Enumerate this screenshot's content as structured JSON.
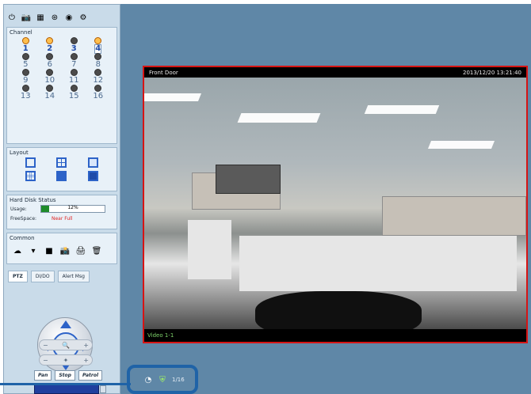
{
  "app": {
    "toolbar": {
      "buttons": [
        {
          "icon": "power-icon"
        },
        {
          "icon": "camera-icon"
        },
        {
          "icon": "color-grid-icon"
        },
        {
          "icon": "network-icon"
        },
        {
          "icon": "globe-icon"
        },
        {
          "icon": "settings-icon"
        }
      ]
    },
    "channel_section": {
      "title": "Channel",
      "channels": [
        {
          "num": "1",
          "active": true,
          "on": true
        },
        {
          "num": "2",
          "active": true,
          "on": true
        },
        {
          "num": "3",
          "active": false,
          "on": true
        },
        {
          "num": "4",
          "active": true,
          "on": true,
          "selected": true
        },
        {
          "num": "5",
          "active": false,
          "on": false
        },
        {
          "num": "6",
          "active": false,
          "on": false
        },
        {
          "num": "7",
          "active": false,
          "on": false
        },
        {
          "num": "8",
          "active": false,
          "on": false
        },
        {
          "num": "9",
          "active": false,
          "on": false
        },
        {
          "num": "10",
          "active": false,
          "on": false
        },
        {
          "num": "11",
          "active": false,
          "on": false
        },
        {
          "num": "12",
          "active": false,
          "on": false
        },
        {
          "num": "13",
          "active": false,
          "on": false
        },
        {
          "num": "14",
          "active": false,
          "on": false
        },
        {
          "num": "15",
          "active": false,
          "on": false
        },
        {
          "num": "16",
          "active": false,
          "on": false
        }
      ]
    },
    "layout_section": {
      "title": "Layout",
      "options": [
        "1-screen-layout-icon",
        "4-screen-layout-icon",
        "6-screen-layout-icon",
        "9-screen-layout-icon",
        "13-screen-layout-icon",
        "16-screen-layout-icon"
      ]
    },
    "disk_section": {
      "title": "Hard Disk Status",
      "usage_label": "Usage:",
      "usage_value": "12%",
      "usage_fraction": 0.12,
      "free_label": "FreeSpace:",
      "free_value": "Near Full"
    },
    "common_section": {
      "title": "Common",
      "buttons": [
        "cloud-icon",
        "dropdown-icon",
        "stop-icon",
        "snapshot-icon",
        "print-icon",
        "trash-icon"
      ]
    },
    "tabs": [
      "PTZ",
      "DI/DO",
      "Alert Msg"
    ],
    "ptz": {
      "zoom_icon": "zoom-icon",
      "focus_icon": "focus-icon",
      "pan": "Pan",
      "stop": "Stop",
      "patrol": "Patrol"
    },
    "viewer": {
      "camera_name": "Front Door",
      "timestamp": "2013/12/20 13:21:40",
      "video_label": "Video 1-1"
    },
    "footer": {
      "icons": [
        "record-icon",
        "shield-icon"
      ],
      "text": "1/16"
    },
    "colors": {
      "left_panel_bg": "#c9dbe9",
      "main_bg": "#5f87a7",
      "accent_blue": "#2d63c8",
      "callout_blue": "#1f63a7",
      "viewer_border": "#d61414"
    }
  }
}
